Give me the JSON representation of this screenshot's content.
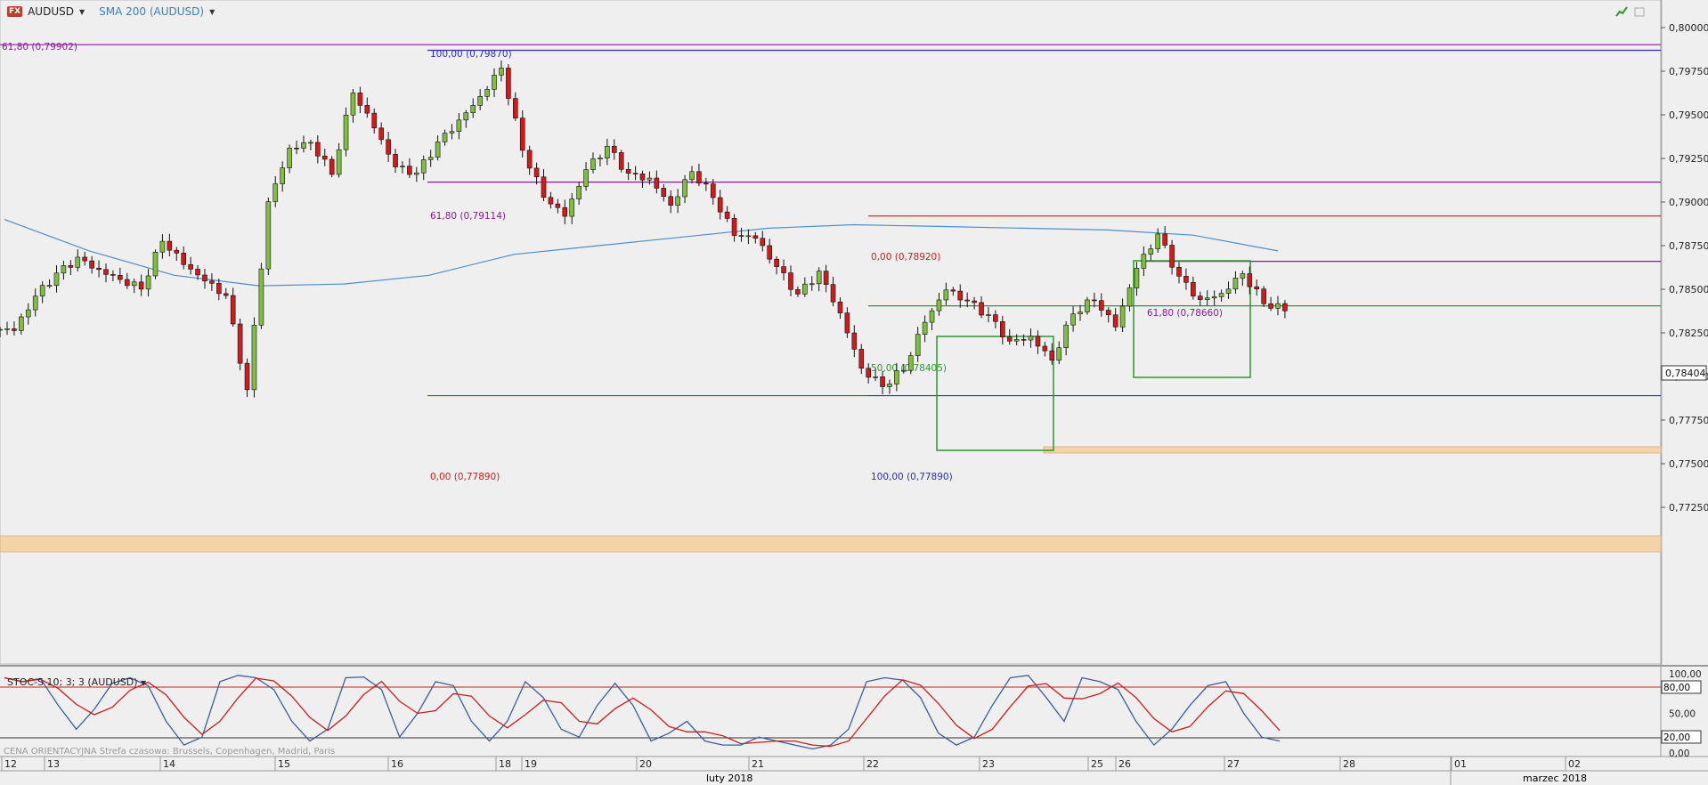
{
  "header": {
    "symbol": "AUDUSD",
    "indicator": "SMA 200 (AUDUSD)",
    "icon": "fx-icon",
    "fx_badge": "FX"
  },
  "oscillator": {
    "label": "STOC-S 10; 3; 3 (AUDUSD)",
    "upper": "80,00",
    "lower": "20,00"
  },
  "footer": {
    "text": "CENA ORIENTACYJNA   Strefa czasowa: Brussels, Copenhagen, Madrid, Paris"
  },
  "colors": {
    "up": "#7fbf3f",
    "down": "#d11a1a",
    "sma": "#4a90d0",
    "fib_purple": "#8b1a9b",
    "fib_red": "#d11a1a",
    "fib_blue": "#2a2acc",
    "fib_green": "#2a9a2a",
    "box": "#2a9a2a",
    "zone": "#f3d3a8"
  },
  "chart_data": {
    "type": "candlestick",
    "price_axis": [
      "0,80000",
      "0,79750",
      "0,79500",
      "0,79250",
      "0,79000",
      "0,78750",
      "0,78500",
      "0,78250",
      "0,78000",
      "0,77750",
      "0,77500",
      "0,77250"
    ],
    "osc_axis": [
      "100,00",
      "50,00",
      "0,00"
    ],
    "current_price": "0,78404",
    "x_ticks": [
      "12",
      "13",
      "14",
      "15",
      "16",
      "18",
      "19",
      "20",
      "21",
      "22",
      "23",
      "25",
      "26",
      "27",
      "28",
      "01",
      "02"
    ],
    "months": [
      "luty 2018",
      "marzec 2018"
    ],
    "fib_levels": [
      {
        "label": "61,80 (0,79902)",
        "color": "purple"
      },
      {
        "label": "100,00 (0,79870)",
        "color": "blue"
      },
      {
        "label": "61,80 (0,79114)",
        "color": "purple"
      },
      {
        "label": "0,00 (0,78920)",
        "color": "red"
      },
      {
        "label": "61,80 (0,78660)",
        "color": "purple"
      },
      {
        "label": "50,00 (0,78405)",
        "color": "green"
      },
      {
        "label": "0,00 (0,77890)",
        "color": "red"
      },
      {
        "label": "100,00 (0,77890)",
        "color": "blue"
      }
    ],
    "close_path": [
      0.7827,
      0.7845,
      0.7857,
      0.7866,
      0.786,
      0.7856,
      0.7852,
      0.788,
      0.7866,
      0.7855,
      0.7845,
      0.779,
      0.7898,
      0.793,
      0.7935,
      0.7918,
      0.7965,
      0.7944,
      0.792,
      0.7915,
      0.7932,
      0.7945,
      0.796,
      0.7978,
      0.7932,
      0.7905,
      0.7893,
      0.7918,
      0.793,
      0.7914,
      0.7912,
      0.7898,
      0.7919,
      0.7905,
      0.7883,
      0.788,
      0.7862,
      0.7845,
      0.7858,
      0.7835,
      0.7805,
      0.7796,
      0.7806,
      0.7833,
      0.785,
      0.7842,
      0.7833,
      0.7818,
      0.7822,
      0.781,
      0.7838,
      0.7846,
      0.783,
      0.7862,
      0.788,
      0.7855,
      0.7842,
      0.7847,
      0.786,
      0.7844,
      0.784
    ],
    "sma_values": [
      0.789,
      0.7872,
      0.7858,
      0.7852,
      0.7853,
      0.7858,
      0.787,
      0.7875,
      0.788,
      0.7885,
      0.7887,
      0.7886,
      0.7885,
      0.7884,
      0.7881,
      0.7872
    ],
    "stoch_k": [
      95,
      90,
      94,
      60,
      30,
      55,
      88,
      95,
      85,
      40,
      10,
      20,
      90,
      98,
      95,
      80,
      40,
      15,
      30,
      95,
      96,
      80,
      20,
      50,
      90,
      85,
      40,
      15,
      40,
      90,
      70,
      30,
      20,
      60,
      88,
      60,
      15,
      25,
      40,
      15,
      10,
      10,
      20,
      15,
      10,
      5,
      10,
      30,
      90,
      95,
      92,
      70,
      25,
      10,
      20,
      60,
      95,
      98,
      70,
      40,
      95,
      90,
      80,
      40,
      10,
      30,
      60,
      85,
      90,
      50,
      20,
      15
    ]
  }
}
